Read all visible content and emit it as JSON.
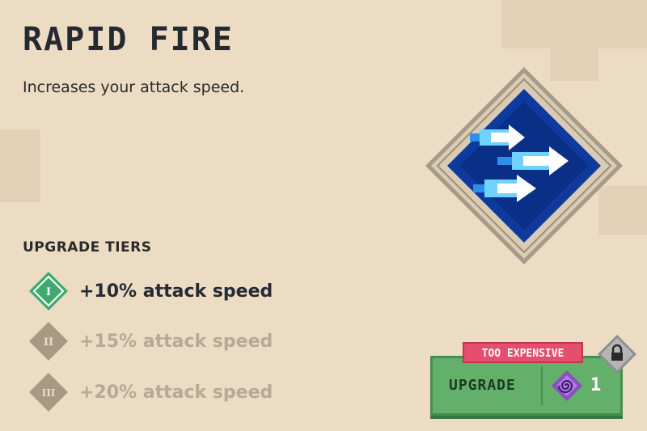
{
  "ability": {
    "title": "RAPID FIRE",
    "description": "Increases your attack speed.",
    "icon": "rapid-fire-arrows-icon"
  },
  "tiers": {
    "heading": "UPGRADE TIERS",
    "items": [
      {
        "numeral": "I",
        "label": "+10% attack speed",
        "unlocked": true
      },
      {
        "numeral": "II",
        "label": "+15% attack speed",
        "unlocked": false
      },
      {
        "numeral": "III",
        "label": "+20% attack speed",
        "unlocked": false
      }
    ]
  },
  "upgrade": {
    "button_label": "UPGRADE",
    "cost": "1",
    "currency_icon": "enchantment-point-spiral-icon",
    "status_label": "TOO EXPENSIVE",
    "lock_icon": "padlock-icon"
  },
  "colors": {
    "background": "#ecdcc4",
    "title_text": "#262a30",
    "tier_active": "#3fa96f",
    "tier_locked": "#b6a995",
    "upgrade_button": "#62b06a",
    "too_expensive_badge": "#e64e6e",
    "icon_frame": "#a59b88",
    "icon_background": "#0d3a9c",
    "currency": "#8b4fc3"
  }
}
